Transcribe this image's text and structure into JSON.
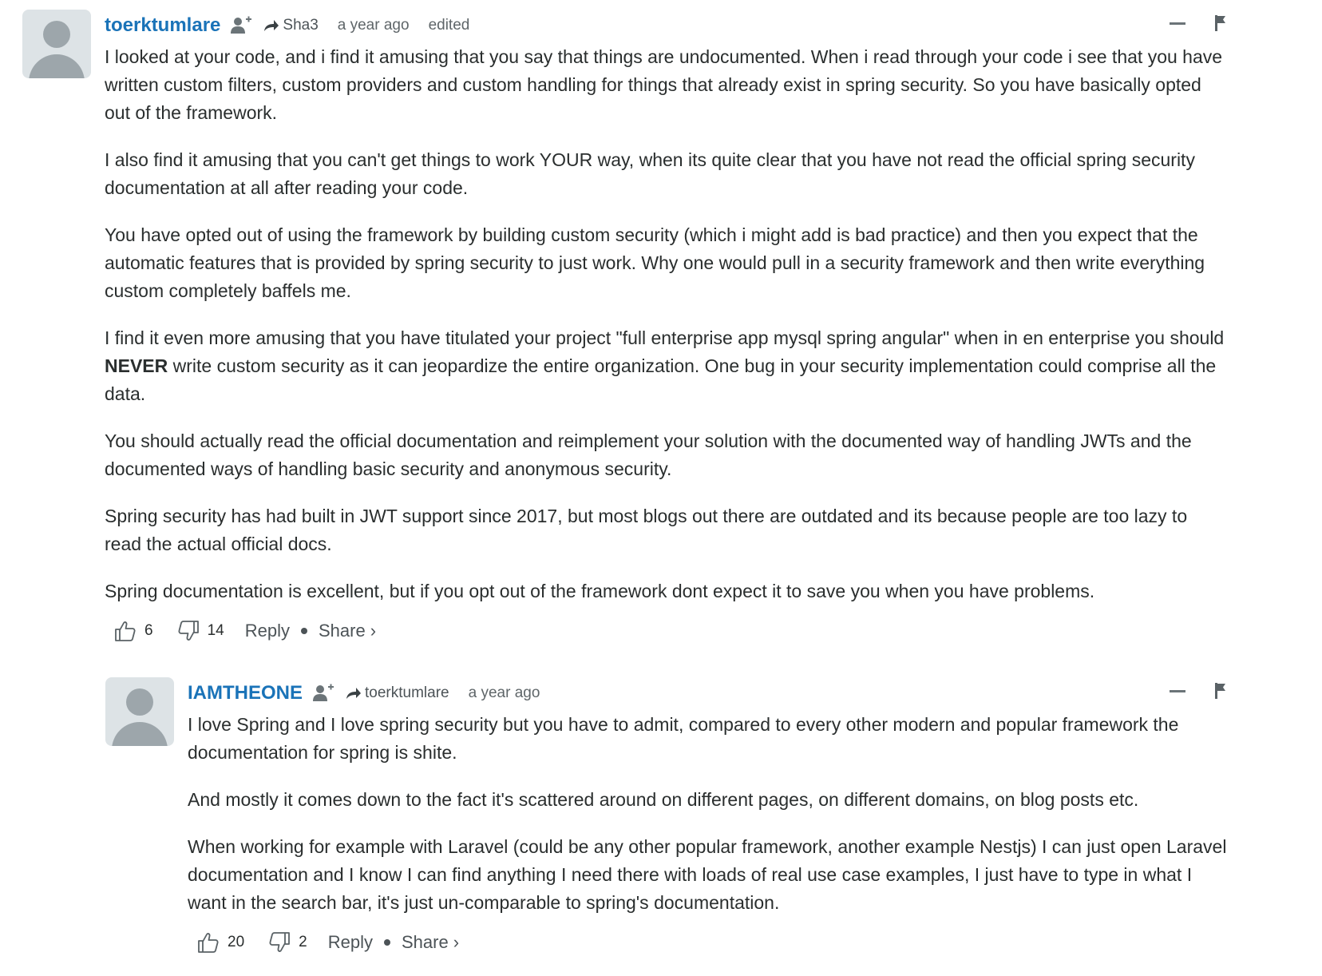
{
  "comments": [
    {
      "author": "toerktumlare",
      "reply_to": "Sha3",
      "time": "a year ago",
      "edited": "edited",
      "paragraphs": [
        "I looked at your code, and i find it amusing that you say that things are undocumented. When i read through your code i see that you have written custom filters, custom providers and custom handling for things that already exist in spring security. So you have basically opted out of the framework.",
        "I also find it amusing that you can't get things to work YOUR way, when its quite clear that you have not read the official spring security documentation at all after reading your code.",
        "You have opted out of using the framework by building custom security (which i might add is bad practice) and then you expect that the automatic features that is provided by spring security to just work. Why one would pull in a security framework and then write everything custom completely baffels me.",
        {
          "before": "I find it even more amusing that you have titulated your project \"full enterprise app mysql spring angular\" when in en enterprise you should ",
          "bold": "NEVER",
          "after": " write custom security as it can jeopardize the entire organization. One bug in your security implementation could comprise all the data."
        },
        "You should actually read the official documentation and reimplement your solution with the documented way of handling JWTs and the documented ways of handling basic security and anonymous security.",
        "Spring security has had built in JWT support since 2017, but most blogs out there are outdated and its because people are too lazy to read the actual official docs.",
        "Spring documentation is excellent, but if you opt out of the framework dont expect it to save you when you have problems."
      ],
      "upvotes": "6",
      "downvotes": "14",
      "reply_label": "Reply",
      "share_label": "Share ›"
    },
    {
      "author": "IAMTHEONE",
      "reply_to": "toerktumlare",
      "time": "a year ago",
      "paragraphs": [
        "I love Spring and I love spring security but you have to admit, compared to every other modern and popular framework the documentation for spring is shite.",
        "And mostly it comes down to the fact it's scattered around on different pages, on different domains, on blog posts etc.",
        "When working for example with Laravel (could be any other popular framework, another example Nestjs) I can just open Laravel documentation and I know I can find anything I need there with loads of real use case examples, I just have to type in what I want in the search bar, it's just un-comparable to spring's documentation."
      ],
      "upvotes": "20",
      "downvotes": "2",
      "reply_label": "Reply",
      "share_label": "Share ›"
    }
  ],
  "icons": {
    "follow": "follow-user-icon",
    "reply_arrow": "reply-arrow-icon",
    "collapse": "collapse-minus-icon",
    "flag": "flag-icon",
    "upvote": "thumbs-up-icon",
    "downvote": "thumbs-down-icon"
  },
  "colors": {
    "author_link": "#1a73b8",
    "text": "#2a2e2e",
    "muted": "#5f6669",
    "avatar_bg": "#dde3e6",
    "avatar_fg": "#9da6ab"
  }
}
